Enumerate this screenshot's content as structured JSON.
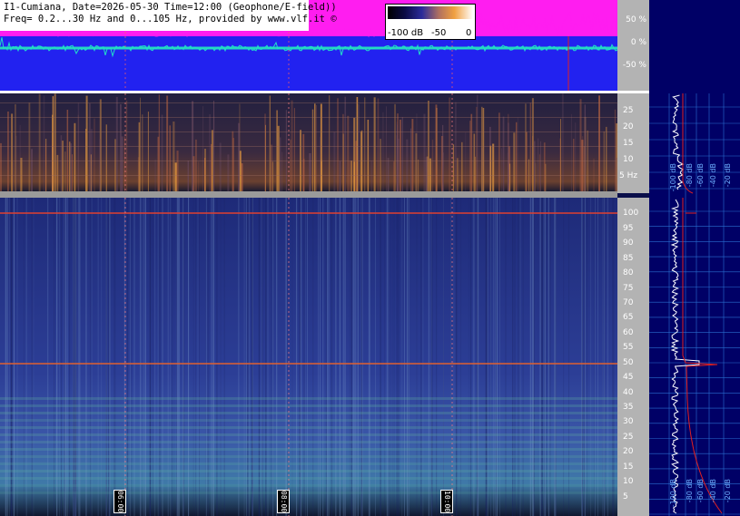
{
  "header": {
    "line1": "I1-Cumiana, Date=2026-05-30 Time=12:00 (Geophone/E-field))",
    "line2": "Freq= 0.2...30 Hz and 0...105 Hz, provided by www.vlf.it ©"
  },
  "colorbar": {
    "min_label": "-100 dB",
    "mid_label": "-50",
    "max_label": "0"
  },
  "timeline_axis": {
    "ticks": [
      "50 %",
      "0 %",
      "-50 %"
    ]
  },
  "time_markers": [
    "06:00",
    "08:00",
    "10:00"
  ],
  "side_db_labels": [
    "-100 dB",
    "-80 dB",
    "-60 dB",
    "-40 dB",
    "-20 dB"
  ],
  "chart_data": [
    {
      "type": "heatmap",
      "title": "",
      "xlabel": "",
      "ylabel": "Hz",
      "ylim": [
        0,
        30
      ],
      "y_ticks": [
        "25",
        "20",
        "15",
        "10",
        "5 Hz"
      ],
      "y_values": [
        25,
        20,
        15,
        10,
        5
      ]
    },
    {
      "type": "heatmap",
      "title": "",
      "xlabel": "",
      "ylabel": "",
      "ylim": [
        0,
        105
      ],
      "y_ticks": [
        "100",
        "95",
        "90",
        "85",
        "80",
        "75",
        "70",
        "65",
        "60",
        "55",
        "50",
        "45",
        "40",
        "35",
        "30",
        "25",
        "20",
        "15",
        "10",
        "5"
      ],
      "y_values": [
        100,
        95,
        90,
        85,
        80,
        75,
        70,
        65,
        60,
        55,
        50,
        45,
        40,
        35,
        30,
        25,
        20,
        15,
        10,
        5
      ],
      "horizontal_lines_hz": [
        100,
        50
      ]
    }
  ],
  "colors": {
    "timeline_bg": "#2222f0",
    "timeline_top": "#ff1df0",
    "panel_bg": "#000066",
    "axis_bg": "#b3b3b3"
  }
}
